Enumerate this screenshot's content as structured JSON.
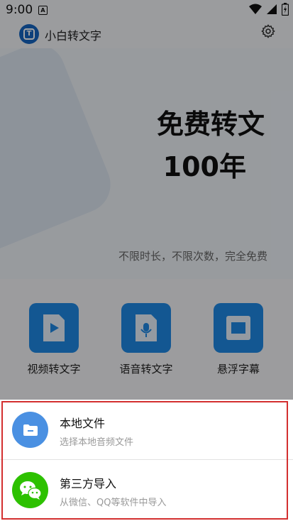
{
  "status_bar": {
    "time": "9:00",
    "badge": "A"
  },
  "header": {
    "app_title": "小白转文字"
  },
  "hero": {
    "line1": "免费转文",
    "line2": "100年",
    "subtitle": "不限时长，不限次数，完全免费"
  },
  "features": [
    {
      "label": "视频转文字",
      "icon": "video-play-icon"
    },
    {
      "label": "语音转文字",
      "icon": "audio-mic-icon"
    },
    {
      "label": "悬浮字幕",
      "icon": "floating-window-icon"
    }
  ],
  "sheet": {
    "options": [
      {
        "title": "本地文件",
        "subtitle": "选择本地音频文件",
        "icon": "folder-icon",
        "color": "#4a90e2"
      },
      {
        "title": "第三方导入",
        "subtitle": "从微信、QQ等软件中导入",
        "icon": "wechat-icon",
        "color": "#2dc100"
      }
    ]
  },
  "colors": {
    "brand": "#1565c0",
    "feature_icon": "#1e88e5",
    "highlight": "#d32f2f"
  }
}
